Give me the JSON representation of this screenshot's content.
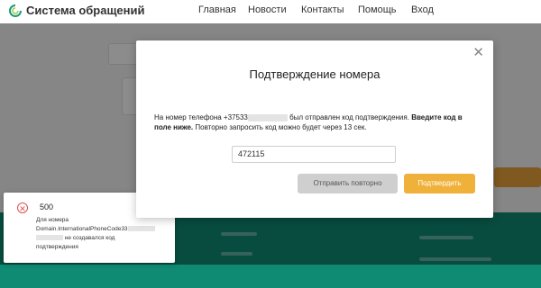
{
  "header": {
    "brand": "Система обращений",
    "nav": [
      "Главная",
      "Новости",
      "Контакты",
      "Помощь",
      "Вход"
    ],
    "brand_color": "#1a9b7b"
  },
  "modal": {
    "title": "Подтверждение номера",
    "text_part1": "На номер телефона +37533",
    "text_part2": " был отправлен код подтверждения. ",
    "text_bold": "Введите код в поле ниже.",
    "text_part3": " Повторно запросить код можно будет через 13 сек.",
    "code_value": "472115",
    "resend_label": "Отправить повторно",
    "confirm_label": "Подтвердить",
    "close_icon": "close-icon",
    "accent": "#f0b13a"
  },
  "toast": {
    "title": "500",
    "body_line1": "Для номера",
    "body_line2": "Domain.InternationalPhoneCode33",
    "body_line3": " не создавался код",
    "body_line4": "подтверждения",
    "icon": "error-icon",
    "error_color": "#d9534f"
  }
}
